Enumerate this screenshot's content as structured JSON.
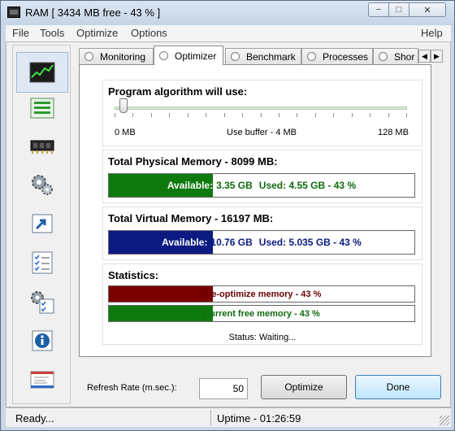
{
  "window": {
    "title": "RAM [ 3434 MB free - 43 % ]",
    "controls": {
      "minimize": "−",
      "maximize": "□",
      "close": "✕"
    }
  },
  "menu": {
    "file": "File",
    "tools": "Tools",
    "optimize": "Optimize",
    "options": "Options",
    "help": "Help"
  },
  "sidebar": {
    "items": [
      {
        "icon": "memory-chart-icon",
        "active": true
      },
      {
        "icon": "list-bars-icon",
        "active": false
      },
      {
        "icon": "ram-chip-icon",
        "active": false
      },
      {
        "icon": "gears-icon",
        "active": false
      },
      {
        "icon": "shortcut-arrow-icon",
        "active": false
      },
      {
        "icon": "checklist-icon",
        "active": false
      },
      {
        "icon": "settings-checklist-icon",
        "active": false
      },
      {
        "icon": "info-icon",
        "active": false
      },
      {
        "icon": "mail-icon",
        "active": false
      }
    ]
  },
  "tabs": [
    {
      "label": "Monitoring",
      "active": false
    },
    {
      "label": "Optimizer",
      "active": true
    },
    {
      "label": "Benchmark",
      "active": false
    },
    {
      "label": "Processes",
      "active": false
    },
    {
      "label": "Shor",
      "active": false
    }
  ],
  "algorithm": {
    "title": "Program algorithm will use:",
    "min_label": "0 MB",
    "mid_label": "Use buffer - 4 MB",
    "max_label": "128 MB",
    "buffer_mb": 4,
    "max_mb": 128
  },
  "physical": {
    "title": "Total Physical Memory - 8099 MB:",
    "available_label": "Available:",
    "available_value": "3.35 GB",
    "used_text": "Used: 4.55 GB - 43 %",
    "fill_fraction": 0.34,
    "color": "#0e7a0e"
  },
  "virtual": {
    "title": "Total Virtual Memory - 16197 MB:",
    "available_label": "Available:",
    "available_value": "10.76 GB",
    "used_text": "Used: 5.035 GB - 43 %",
    "fill_fraction": 0.34,
    "color": "#0c1a82"
  },
  "statistics": {
    "title": "Statistics:",
    "pre_text": "Pre-optimize memory - 43 %",
    "pre_fraction": 0.34,
    "pre_color": "#7a0000",
    "current_text": "Current free memory - 43 %",
    "current_fraction": 0.34,
    "current_color": "#0e7a0e",
    "status": "Status: Waiting..."
  },
  "bottom": {
    "refresh_label": "Refresh Rate (m.sec.):",
    "refresh_value": "50",
    "optimize_button": "Optimize",
    "done_button": "Done"
  },
  "statusbar": {
    "ready": "Ready...",
    "uptime": "Uptime - 01:26:59"
  }
}
